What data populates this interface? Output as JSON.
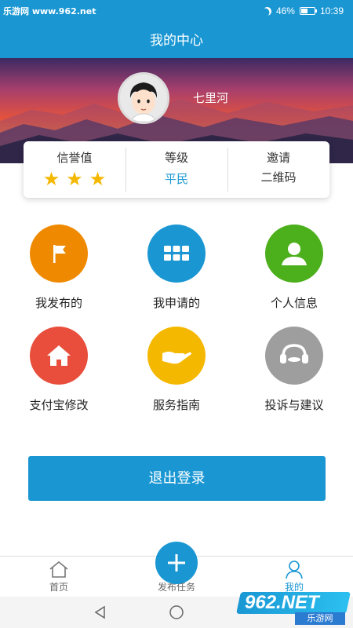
{
  "status_bar": {
    "watermark": "乐游网 www.962.net",
    "battery": "46%",
    "time": "10:39"
  },
  "title": "我的中心",
  "profile": {
    "username": "七里河"
  },
  "info": {
    "credit_label": "信誉值",
    "credit_stars": 3,
    "level_label": "等级",
    "level_value": "平民",
    "invite_label": "邀请",
    "invite_sub": "二维码"
  },
  "menu": [
    {
      "label": "我发布的",
      "icon": "flag-icon",
      "color": "#ef8a00"
    },
    {
      "label": "我申请的",
      "icon": "grid-icon",
      "color": "#1a97d3"
    },
    {
      "label": "个人信息",
      "icon": "person-icon",
      "color": "#4caf1c"
    },
    {
      "label": "支付宝修改",
      "icon": "home-icon",
      "color": "#e84e3b"
    },
    {
      "label": "服务指南",
      "icon": "hand-icon",
      "color": "#f5b800"
    },
    {
      "label": "投诉与建议",
      "icon": "headset-icon",
      "color": "#9e9e9e"
    }
  ],
  "logout_label": "退出登录",
  "nav": {
    "home": "首页",
    "publish": "发布任务",
    "mine": "我的"
  },
  "watermark_bottom": {
    "logo": "962.NET",
    "sub": "乐游网"
  },
  "colors": {
    "primary": "#1a97d3",
    "star": "#f5b800"
  }
}
